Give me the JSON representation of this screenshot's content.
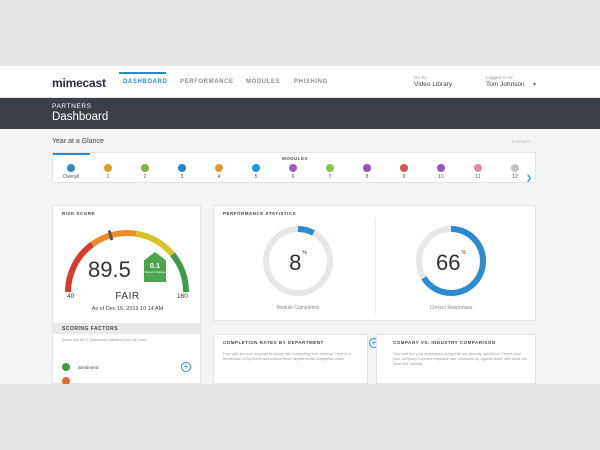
{
  "app": {
    "logo": "mimecast",
    "nav": {
      "tabs": [
        {
          "label": "DASHBOARD"
        },
        {
          "label": "PERFORMANCE"
        },
        {
          "label": "MODULES"
        },
        {
          "label": "PHISHING"
        }
      ],
      "goto_label": "Go To:",
      "goto_value": "Video Library",
      "logged_label": "Logged In As:",
      "user_name": "Tom Johnson"
    },
    "accent_color": "#2b8bd1"
  },
  "banner": {
    "subtitle": "PARTNERS",
    "title": "Dashboard"
  },
  "section": {
    "title": "Year at a Glance",
    "export_label": "EXPORT"
  },
  "modules": {
    "title": "MODULES",
    "items": [
      {
        "label": "Overall",
        "color": "#2b8bd1"
      },
      {
        "label": "1",
        "color": "#e0a21a"
      },
      {
        "label": "2",
        "color": "#7cb342"
      },
      {
        "label": "3",
        "color": "#1e88c8"
      },
      {
        "label": "4",
        "color": "#e0a21a"
      },
      {
        "label": "5",
        "color": "#1e9ad6"
      },
      {
        "label": "6",
        "color": "#9c5fc4"
      },
      {
        "label": "7",
        "color": "#8bc34a"
      },
      {
        "label": "8",
        "color": "#9b4dbd"
      },
      {
        "label": "9",
        "color": "#d9534f"
      },
      {
        "label": "10",
        "color": "#8e5ac8"
      },
      {
        "label": "11",
        "color": "#e68aa0"
      },
      {
        "label": "12",
        "color": "#bfc3c9"
      }
    ]
  },
  "risk": {
    "title": "RISK SCORE",
    "score": "89.5",
    "change_value": "0.1",
    "change_label": "Recent Change",
    "min": "40",
    "max": "160",
    "rating": "FAIR",
    "as_of": "As of Dec 16, 2019 10:14 AM",
    "gauge_fraction": 0.41,
    "scoring": {
      "title": "SCORING FACTORS",
      "description": "Select how the 6 components influence your risk score",
      "factors": [
        {
          "label": "Sentiment"
        }
      ]
    }
  },
  "performance": {
    "title": "PERFORMANCE STATISTICS",
    "stats": [
      {
        "value": "8",
        "unit": "%",
        "percent": 8,
        "label": "Module Completion"
      },
      {
        "value": "66",
        "unit": "%",
        "percent": 66,
        "label": "Correct Responses"
      }
    ]
  },
  "completion": {
    "title": "COMPLETION RATES BY DEPARTMENT",
    "text": "How well are your employees doing with completing their training? Here is a breakdown of top three and bottom three departmental completion rates."
  },
  "industry": {
    "title": "COMPANY VS. INDUSTRY COMPARISON",
    "text": "How well are your employees doing with our security questions? Here's how your company's correct response rate measures up against those who have not taken the training."
  }
}
